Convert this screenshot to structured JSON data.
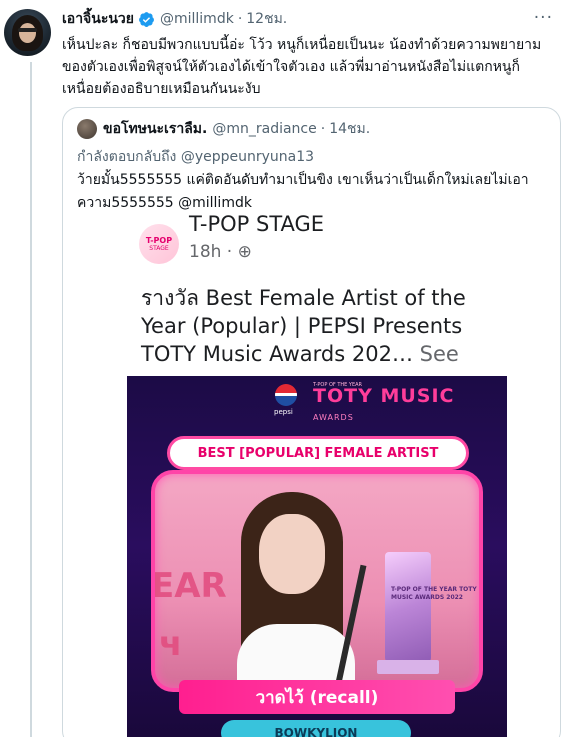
{
  "tweet": {
    "display_name": "เอาจิ้นะนวย",
    "verified_icon": "verified-badge-icon",
    "handle": "@millimdk",
    "separator": "·",
    "time": "12ชม.",
    "more_label": "···",
    "text": "เห็นปะละ ก็ชอบมีพวกแบบนี้อ่ะ โว้ว หนูก็เหนื่อยเป็นนะ น้องทำด้วยความพยายามของตัวเองเพื่อพิสูจน์ให้ตัวเองได้เข้าใจตัวเอง แล้วพี่มาอ่านหนังสือไม่แตกหนูก็เหนื่อยต้องอธิบายเหมือนกันนะงับ"
  },
  "quote": {
    "display_name": "ขอโทษนะเราลืม.",
    "handle": "@mn_radiance",
    "separator": "·",
    "time": "14ชม.",
    "reply_prefix": "กำลังตอบกลับถึง",
    "reply_mention": "@yeppeunryuna13",
    "text": "ว้ายมั้น5555555 แค่ติดอันดับทำมาเป็นขิง เขาเห็นว่าเป็นเด็กใหม่เลยไม่เอาความ5555555 @millimdk",
    "embedded_post": {
      "logo_text_large": "T-POP",
      "logo_text_small": "STAGE",
      "page_name": "T-POP STAGE",
      "time": "18h · ⊕",
      "caption": "รางวัล Best Female Artist of the Year (Popular) | PEPSI Presents TOTY Music Awards 202…",
      "see_more": "See more",
      "poster": {
        "pepsi_label": "pepsi",
        "toty_small": "T-POP OF THE YEAR",
        "toty_title": "TOTY MUSIC",
        "toty_sub": "AWARDS",
        "award_title": "BEST [POPULAR] FEMALE ARTIST",
        "background_text_1": "EAR",
        "background_text_2": "ч",
        "trophy_text": "T-POP OF THE YEAR TOTY MUSIC AWARDS 2022",
        "song_title": "วาดไว้ (recall)",
        "artist": "BOWKYLION"
      }
    }
  },
  "colors": {
    "text_primary": "#0f1419",
    "text_secondary": "#536471",
    "verified": "#1d9bf0",
    "border": "#cfd9de",
    "poster_pink": "#ff44a8",
    "poster_bg": "#1c0b46"
  }
}
